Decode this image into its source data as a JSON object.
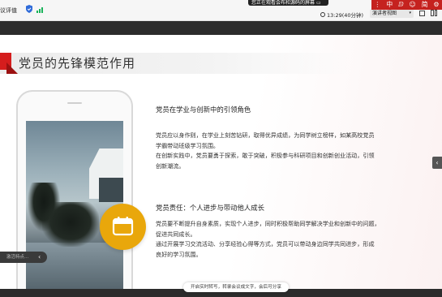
{
  "topbar": {
    "meeting_title": "议评值",
    "share_banner": "您正在观看会布和源码的屏幕",
    "share_icon": "screen-share-icon",
    "timer": "13:29(40分钟)",
    "timer_icon": "clock-icon",
    "view_label": "演讲者视图",
    "colors": {
      "shield": "#2f6bd9",
      "signal": "#19b35a"
    }
  },
  "ime": {
    "items": [
      "中",
      "ⅅ",
      "☺",
      "简",
      "⚙"
    ],
    "color": "#c5221f"
  },
  "slide": {
    "title": "党员的先锋模范作用",
    "accent_color": "#d51d1d",
    "section1": {
      "heading": "党员在学业与创新中的引领角色",
      "lines": [
        "党员应以身作则，在学业上刻苦钻研，取得优异成绩，为同学树立榜样，如某高校党员",
        "学霸带动班级学习氛围。",
        "在创新实践中，党员要勇于探索，敢于突破，积极参与科研项目和创新创业活动，引领",
        "创新潮流。"
      ]
    },
    "section2": {
      "heading": "党员责任：个人进步与带动他人成长",
      "lines": [
        "党员要不断提升自身素质，实现个人进步，同时积极帮助同学解决学业和创新中的问题，",
        "促进共同成长。",
        "通过开展学习交流活动、分享经验心得等方式，党员可以带动身边同学共同进步，形成",
        "良好的学习氛围。"
      ]
    },
    "icon_circle_color": "#e9a70b",
    "icon": "calendar-icon"
  },
  "overlay": {
    "left_pill": "激活特点...",
    "subtitle_banner": "开启实时转写，转录会议成文字，会后可分享",
    "side_arrow": "‹"
  }
}
